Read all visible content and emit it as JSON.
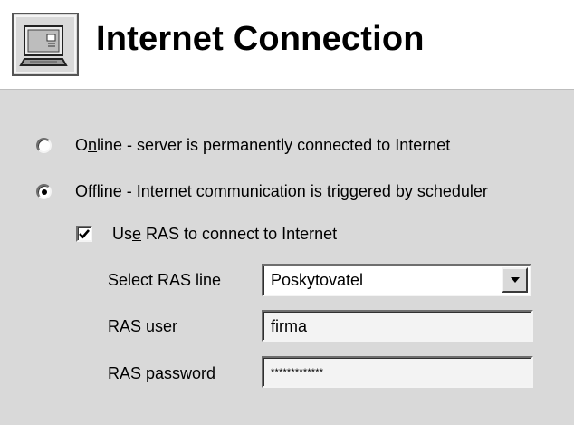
{
  "header": {
    "title": "Internet Connection",
    "icon": "network-computer-icon"
  },
  "connection_mode": {
    "selected": "offline",
    "online": {
      "hotkey": "n",
      "prefix": "O",
      "rest": "line - server is permanently connected to Internet"
    },
    "offline": {
      "hotkey": "f",
      "prefix": "O",
      "rest": "fline - Internet communication is triggered by scheduler"
    }
  },
  "use_ras": {
    "checked": true,
    "prefix": "Us",
    "hotkey": "e",
    "rest": " RAS to connect to Internet"
  },
  "ras_line": {
    "label": "Select RAS line",
    "value": "Poskytovatel"
  },
  "ras_user": {
    "label": "RAS user",
    "value": "firma"
  },
  "ras_password": {
    "label": "RAS password",
    "value": "*************"
  }
}
